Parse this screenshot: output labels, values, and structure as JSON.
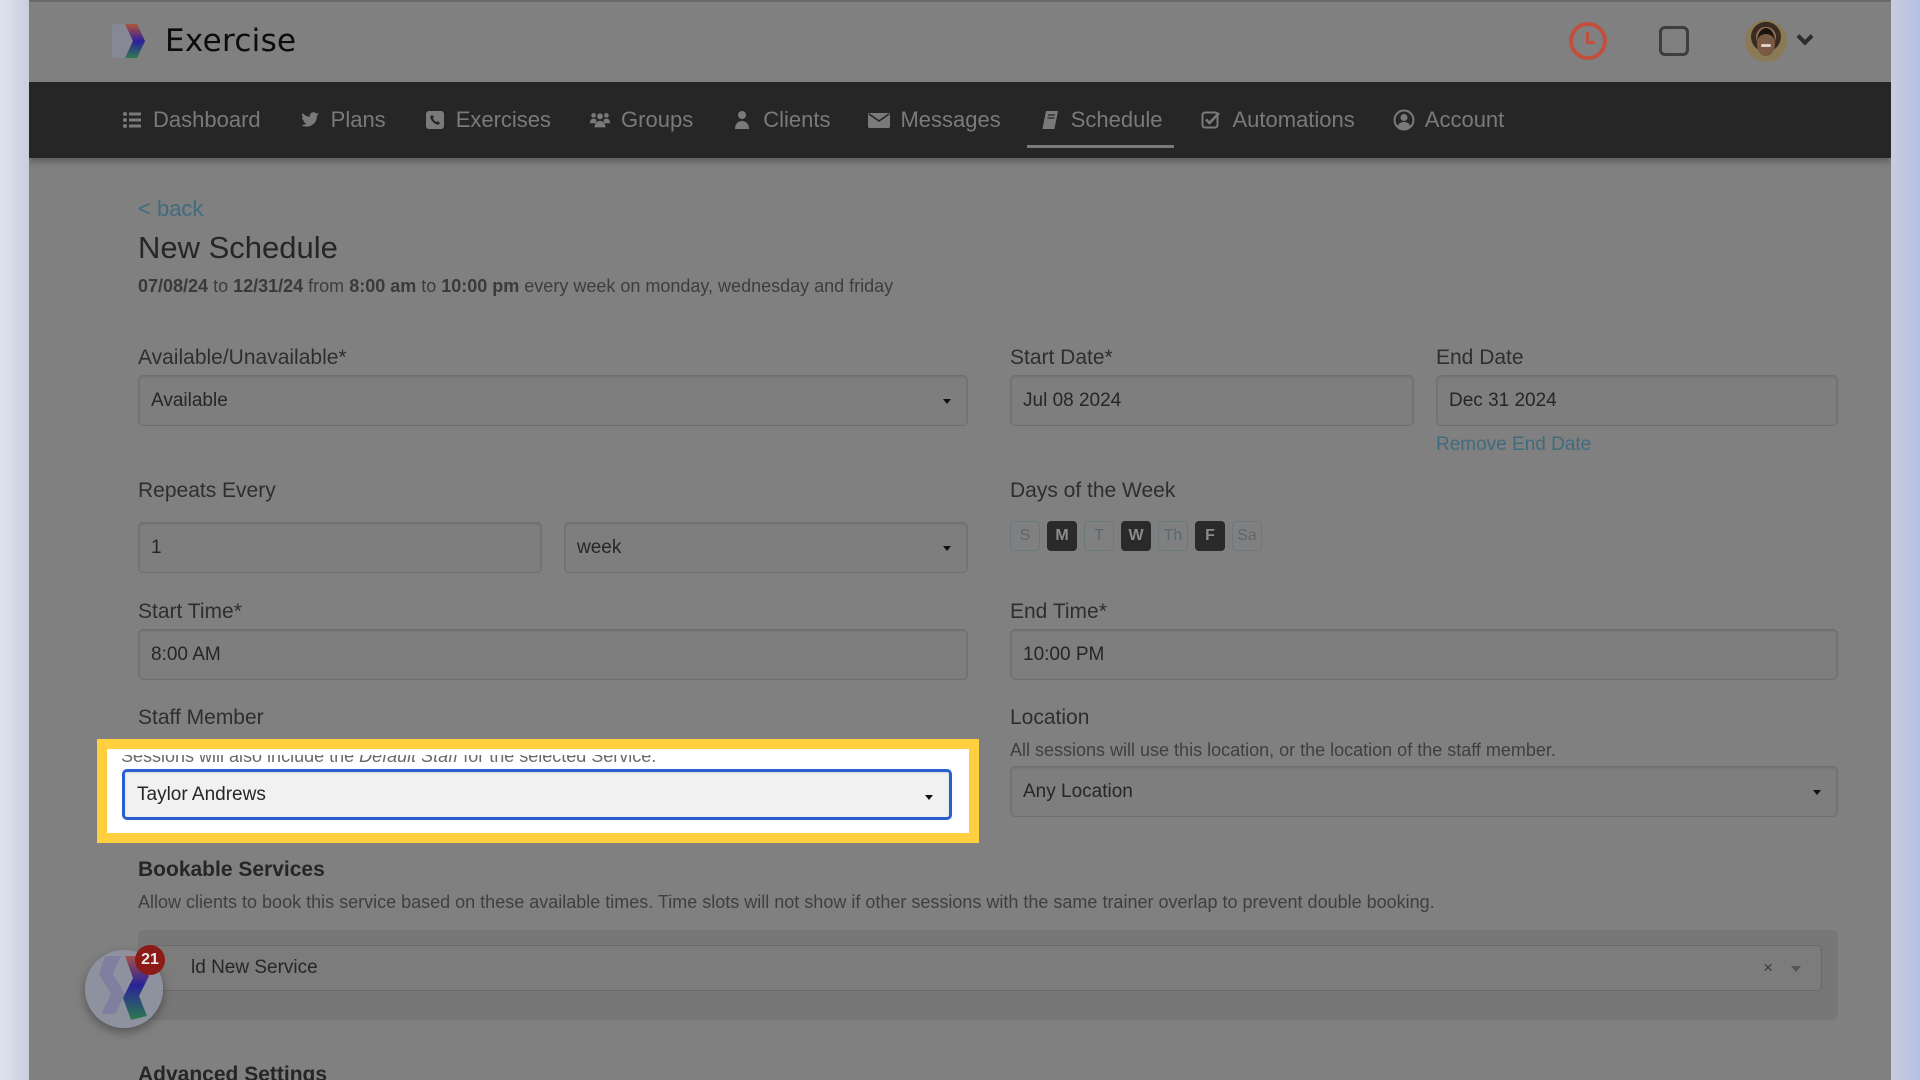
{
  "app": {
    "name": "Exercise"
  },
  "topbar": {
    "icons": [
      "clock-icon",
      "square-icon",
      "avatar",
      "chevron-down-icon"
    ],
    "clock_color": "#c0503d"
  },
  "nav": {
    "items": [
      {
        "label": "Dashboard",
        "icon": "list-icon",
        "glyph": "☰"
      },
      {
        "label": "Plans",
        "icon": "twitter-bird-icon",
        "glyph": "🐦"
      },
      {
        "label": "Exercises",
        "icon": "phone-square-icon",
        "glyph": "☎"
      },
      {
        "label": "Groups",
        "icon": "users-icon",
        "glyph": "👥"
      },
      {
        "label": "Clients",
        "icon": "user-icon",
        "glyph": "👤"
      },
      {
        "label": "Messages",
        "icon": "envelope-icon",
        "glyph": "✉"
      },
      {
        "label": "Schedule",
        "icon": "book-icon",
        "glyph": "📘"
      },
      {
        "label": "Automations",
        "icon": "check-square-icon",
        "glyph": "☑"
      },
      {
        "label": "Account",
        "icon": "user-circle-icon",
        "glyph": "◉"
      }
    ],
    "active": "Schedule"
  },
  "page": {
    "back_label": "< back",
    "title": "New Schedule",
    "summary": {
      "start_date": "07/08/24",
      "to1": " to ",
      "end_date": "12/31/24",
      "from": " from ",
      "start_time": "8:00 am",
      "to2": " to ",
      "end_time": "10:00 pm",
      "rest": " every week on monday, wednesday and friday"
    }
  },
  "form": {
    "availability": {
      "label": "Available/Unavailable*",
      "value": "Available"
    },
    "start_date": {
      "label": "Start Date*",
      "value": "Jul 08 2024"
    },
    "end_date": {
      "label": "End Date",
      "value": "Dec 31 2024",
      "remove_link": "Remove End Date"
    },
    "repeats": {
      "label": "Repeats Every",
      "count": "1",
      "unit": "week"
    },
    "days": {
      "label": "Days of the Week",
      "items": [
        {
          "label": "S",
          "selected": false
        },
        {
          "label": "M",
          "selected": true
        },
        {
          "label": "T",
          "selected": false
        },
        {
          "label": "W",
          "selected": true
        },
        {
          "label": "Th",
          "selected": false
        },
        {
          "label": "F",
          "selected": true
        },
        {
          "label": "Sa",
          "selected": false
        }
      ]
    },
    "start_time": {
      "label": "Start Time*",
      "value": "8:00 AM"
    },
    "end_time": {
      "label": "End Time*",
      "value": "10:00 PM"
    },
    "staff": {
      "label": "Staff Member",
      "help_pre": "Sessions will also include the ",
      "help_em": "Default Staff",
      "help_post": " for the selected Service.",
      "value": "Taylor Andrews"
    },
    "location": {
      "label": "Location",
      "help": "All sessions will use this location, or the location of the staff member.",
      "value": "Any Location"
    },
    "bookable": {
      "title": "Bookable Services",
      "help": "Allow clients to book this service based on these available times. Time slots will not show if other sessions with the same trainer overlap to prevent double booking.",
      "placeholder": "Add New Service",
      "visible_text": "ld New Service",
      "clear": "×"
    },
    "advanced_title": "Advanced Settings"
  },
  "chat": {
    "badge_count": "21"
  },
  "highlight_color": "#ffcf3f"
}
